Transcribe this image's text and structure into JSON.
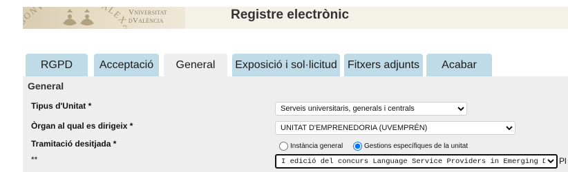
{
  "header": {
    "university_line1": "Vniversitat",
    "university_line2": "dValència",
    "seal_inscription": "AGONVM DECUS · ALEXAND",
    "title": "Registre electrònic"
  },
  "tabs": [
    {
      "label": "RGPD",
      "active": false
    },
    {
      "label": "Acceptació",
      "active": false
    },
    {
      "label": "General",
      "active": true
    },
    {
      "label": "Exposició i sol·licitud",
      "active": false
    },
    {
      "label": "Fitxers adjunts",
      "active": false
    },
    {
      "label": "Acabar",
      "active": false
    }
  ],
  "section": {
    "title": "General"
  },
  "fields": {
    "tipus_unitat": {
      "label": "Tipus d'Unitat *",
      "selected": "Serveis universitaris, generals i centrals"
    },
    "organ": {
      "label": "Òrgan al qual es dirigeix *",
      "selected": "UNITAT D'EMPRENEDORIA (UVEMPRÉN)"
    },
    "tramitacio": {
      "label": "Tramitació desitjada *",
      "options": [
        {
          "label": "Instància general",
          "checked": false
        },
        {
          "label": "Gestions específiques de la unitat",
          "checked": true
        }
      ]
    },
    "gestio": {
      "label": "**",
      "selected": "I edició del concurs Language Service Providers in Emerging Digital Markets",
      "overflow_text": "Pl"
    }
  },
  "colors": {
    "tab_bg": "#bfdbe7",
    "panel_bg": "#eeeeee",
    "header_bg": "#f3f1e8"
  }
}
